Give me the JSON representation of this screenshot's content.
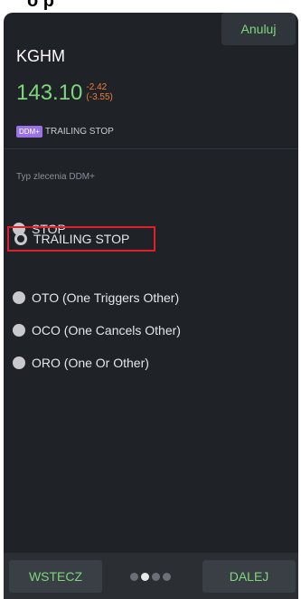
{
  "top_fragment": "o                  p",
  "header": {
    "cancel_label": "Anuluj"
  },
  "instrument": {
    "ticker": "KGHM",
    "price": "143.10",
    "change_abs": "-2.42",
    "change_pct": "(-3.55)",
    "badge": "DDM+",
    "order_type": "TRAILING STOP"
  },
  "form": {
    "section_label": "Typ zlecenia DDM+",
    "options": [
      {
        "label": "STOP",
        "selected": false
      },
      {
        "label": "TRAILING STOP",
        "selected": true
      },
      {
        "label": "OTO (One Triggers Other)",
        "selected": false
      },
      {
        "label": "OCO (One Cancels Other)",
        "selected": false
      },
      {
        "label": "ORO (One Or Other)",
        "selected": false
      }
    ]
  },
  "footer": {
    "back_label": "WSTECZ",
    "next_label": "DALEJ",
    "step_current": 2,
    "step_total": 4
  },
  "colors": {
    "accent_green": "#7dd87a",
    "change_orange": "#f07c39",
    "badge_purple": "#9b72e6",
    "highlight_red": "#e0202a",
    "background": "#1f2227"
  }
}
